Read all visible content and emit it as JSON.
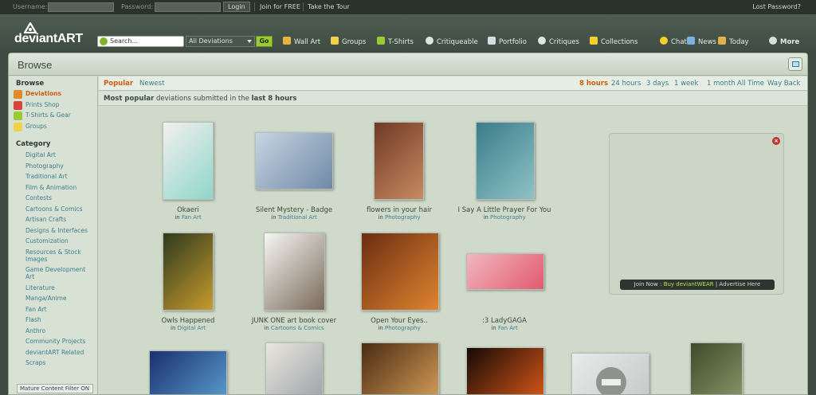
{
  "topbar": {
    "username_label": "Username:",
    "password_label": "Password:",
    "login_button": "Login",
    "join_link": "Join for FREE",
    "tour_link": "Take the Tour",
    "lost_password": "Lost Password?"
  },
  "header": {
    "logo_text": "deviantART",
    "search_placeholder": "Search...",
    "scope_selected": "All Deviations",
    "go_button": "Go",
    "nav": [
      {
        "label": "Wall Art",
        "icon": "frame-icon",
        "color": "#e8b33a"
      },
      {
        "label": "Groups",
        "icon": "house-icon",
        "color": "#f0d24a"
      },
      {
        "label": "T-Shirts",
        "icon": "tshirt-icon",
        "color": "#9acb34"
      },
      {
        "label": "Critiqueable",
        "icon": "speech-icon",
        "color": "#dfe6df"
      },
      {
        "label": "Portfolio",
        "icon": "portfolio-icon",
        "color": "#d7dde0"
      },
      {
        "label": "Critiques",
        "icon": "critique-icon",
        "color": "#dfe6df"
      },
      {
        "label": "Collections",
        "icon": "star-icon",
        "color": "#f2cf2a"
      },
      {
        "label": "Chat",
        "icon": "smiley-icon",
        "color": "#f2cf2a"
      },
      {
        "label": "News",
        "icon": "news-icon",
        "color": "#7fb0e0"
      },
      {
        "label": "Today",
        "icon": "today-icon",
        "color": "#e0b24a"
      },
      {
        "label": "More",
        "icon": "more-icon",
        "color": "#d8e0d8"
      }
    ]
  },
  "panel": {
    "title": "Browse"
  },
  "sidebar": {
    "browse_heading": "Browse",
    "browse_items": [
      {
        "label": "Deviations",
        "icon": "deviations-icon",
        "color": "#e08a2a",
        "selected": true
      },
      {
        "label": "Prints Shop",
        "icon": "prints-icon",
        "color": "#d9453a",
        "selected": false
      },
      {
        "label": "T-Shirts & Gear",
        "icon": "tshirt-icon",
        "color": "#9acb34",
        "selected": false
      },
      {
        "label": "Groups",
        "icon": "house-icon",
        "color": "#f0d24a",
        "selected": false
      }
    ],
    "category_heading": "Category",
    "categories": [
      "Digital Art",
      "Photography",
      "Traditional Art",
      "Film & Animation",
      "Contests",
      "Cartoons & Comics",
      "Artisan Crafts",
      "Designs & Interfaces",
      "Customization",
      "Resources & Stock Images",
      "Game Development Art",
      "Literature",
      "Manga/Anime",
      "Fan Art",
      "Flash",
      "Anthro",
      "Community Projects",
      "deviantART Related",
      "Scraps"
    ],
    "mature_filter": "Mature Content Filter ON"
  },
  "tabs": {
    "left": [
      {
        "label": "Popular",
        "active": true
      },
      {
        "label": "Newest",
        "active": false
      }
    ],
    "right": [
      {
        "label": "8 hours",
        "active": true
      },
      {
        "label": "24 hours",
        "active": false
      },
      {
        "label": "3 days",
        "active": false
      },
      {
        "label": "1 week",
        "active": false
      },
      {
        "label": "1 month",
        "active": false
      },
      {
        "label": "All Time",
        "active": false
      },
      {
        "label": "Way Back",
        "active": false
      }
    ]
  },
  "subtitle": {
    "bold1": "Most popular",
    "middle": " deviations submitted in the ",
    "bold2": "last 8 hours"
  },
  "deviations": [
    {
      "title": "Okaeri",
      "in": "in",
      "category": "Fan Art",
      "colors": [
        "#f3f0ee",
        "#8fd6c9"
      ]
    },
    {
      "title": "Silent Mystery - Badge",
      "in": "in",
      "category": "Traditional Art",
      "colors": [
        "#c7d5e3",
        "#6f8aa6"
      ]
    },
    {
      "title": "flowers in your hair",
      "in": "in",
      "category": "Photography",
      "colors": [
        "#6e3a25",
        "#c98a62"
      ]
    },
    {
      "title": "I Say A Little Prayer For You",
      "in": "in",
      "category": "Photography",
      "colors": [
        "#3a7d89",
        "#8fc2c7"
      ]
    },
    {
      "title": "Owls Happened",
      "in": "in",
      "category": "Digital Art",
      "colors": [
        "#2d3a1e",
        "#c79a2e"
      ]
    },
    {
      "title": "JUNK ONE art book cover",
      "in": "in",
      "category": "Cartoons & Comics",
      "colors": [
        "#f6f6f3",
        "#7a6a5a"
      ]
    },
    {
      "title": "Open Your Eyes..",
      "in": "in",
      "category": "Photography",
      "colors": [
        "#6a2e12",
        "#e0842e"
      ]
    },
    {
      "title": ":3 LadyGAGA",
      "in": "in",
      "category": "Fan Art",
      "colors": [
        "#f0b7bf",
        "#e25a6e"
      ]
    },
    {
      "title": "",
      "in": "",
      "category": "",
      "colors": [
        "#1b2f6e",
        "#5aa0d0"
      ]
    },
    {
      "title": "",
      "in": "",
      "category": "",
      "colors": [
        "#eae6de",
        "#9aa0a8"
      ]
    },
    {
      "title": "",
      "in": "",
      "category": "",
      "colors": [
        "#4a2a12",
        "#d9a25a"
      ]
    },
    {
      "title": "",
      "in": "",
      "category": "",
      "colors": [
        "#150a05",
        "#e05a1a"
      ]
    },
    {
      "title": "",
      "in": "",
      "category": "",
      "colors": [
        "#e8ebea",
        "#c3c7c5"
      ]
    },
    {
      "title": "",
      "in": "",
      "category": "",
      "colors": [
        "#3e4a2a",
        "#8a9a6a"
      ]
    }
  ],
  "ad": {
    "join_now": "Join Now",
    "buy_link": "Buy deviantWEAR",
    "advertise": "Advertise Here"
  }
}
